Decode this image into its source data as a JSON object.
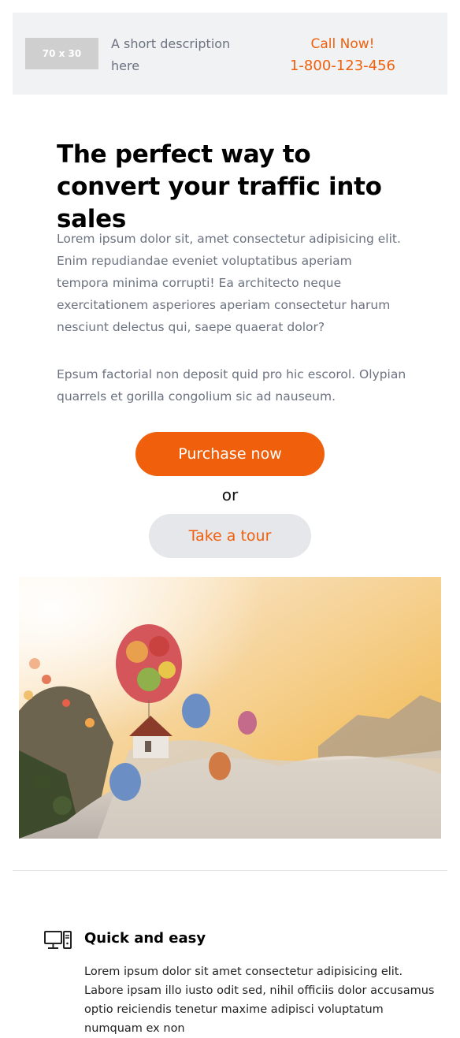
{
  "header": {
    "logo_placeholder": "70 x 30",
    "description": "A short description here",
    "call_label": "Call Now!",
    "phone": "1-800-123-456"
  },
  "hero": {
    "title": "The perfect way to convert your traffic into sales",
    "paragraph1": "Lorem ipsum dolor sit, amet consectetur adipisicing elit. Enim repudiandae eveniet voluptatibus aperiam tempora minima corrupti! Ea architecto neque exercitationem asperiores aperiam consectetur harum nesciunt delectus qui, saepe quaerat dolor?",
    "paragraph2": "Epsum factorial non deposit quid pro hic escorol. Olypian quarrels et gorilla congolium sic ad nauseum.",
    "primary_button": "Purchase now",
    "separator": "or",
    "secondary_button": "Take a tour"
  },
  "feature": {
    "icon": "desktop-computer-icon",
    "title": "Quick and easy",
    "text": "Lorem ipsum dolor sit amet consectetur adipisicing elit. Labore ipsam illo iusto odit sed, nihil officiis dolor accusamus optio reiciendis tenetur maxime adipisci voluptatum numquam ex non"
  },
  "colors": {
    "accent": "#f0600c",
    "topbar_bg": "#f1f2f4",
    "secondary_button_bg": "#e6e7ea",
    "muted_text": "#6b7280"
  }
}
